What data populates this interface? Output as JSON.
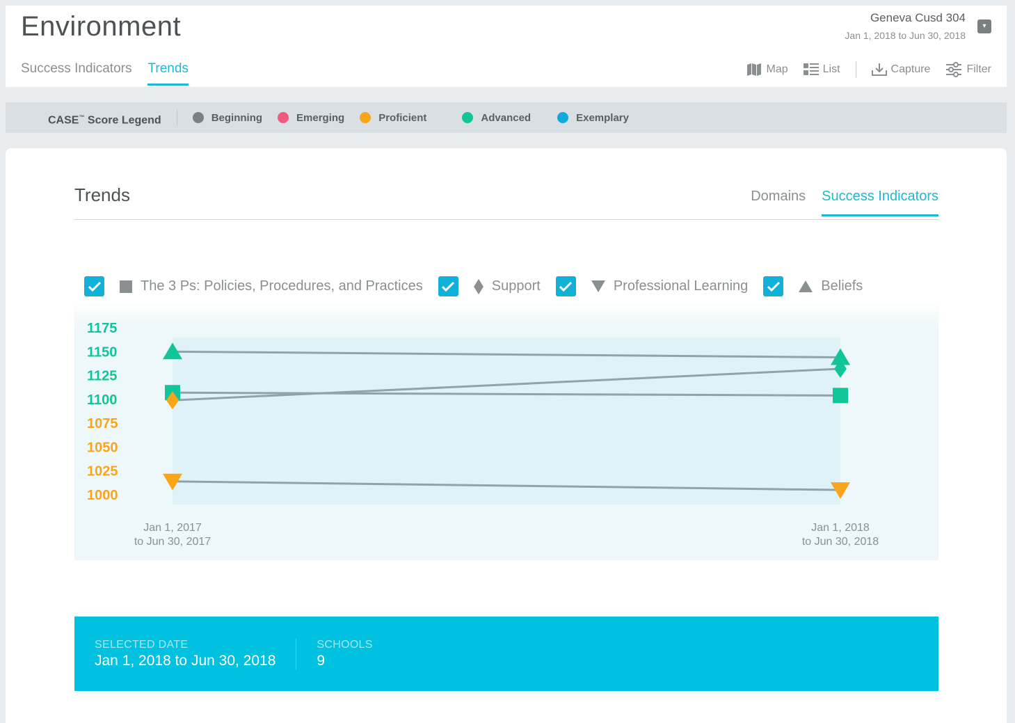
{
  "header": {
    "title": "Environment",
    "tabs": [
      {
        "label": "Success Indicators",
        "active": false
      },
      {
        "label": "Trends",
        "active": true
      }
    ],
    "district": {
      "name": "Geneva Cusd 304",
      "range": "Jan 1, 2018 to Jun 30, 2018"
    },
    "toolbar": {
      "map": "Map",
      "list": "List",
      "capture": "Capture",
      "filter": "Filter"
    }
  },
  "legend": {
    "title": "CASE",
    "title_mark": "™",
    "title_suffix": " Score Legend",
    "items": [
      {
        "label": "Beginning",
        "color": "#7b8083"
      },
      {
        "label": "Emerging",
        "color": "#ef5b7c"
      },
      {
        "label": "Proficient",
        "color": "#f9a51a"
      },
      {
        "label": "Advanced",
        "color": "#11c598"
      },
      {
        "label": "Exemplary",
        "color": "#12a9e0"
      }
    ]
  },
  "card": {
    "title": "Trends",
    "tabs": [
      {
        "label": "Domains",
        "active": false
      },
      {
        "label": "Success Indicators",
        "active": true
      }
    ]
  },
  "series_toggles": [
    {
      "label": "The 3 Ps: Policies, Procedures, and Practices",
      "icon": "square-icon",
      "checked": true
    },
    {
      "label": "Support",
      "icon": "diamond-icon",
      "checked": true
    },
    {
      "label": "Professional Learning",
      "icon": "triangle-down-icon",
      "checked": true
    },
    {
      "label": "Beliefs",
      "icon": "triangle-up-icon",
      "checked": true
    }
  ],
  "chart_data": {
    "type": "line",
    "x": [
      "Jan 1, 2017 to Jun 30, 2017",
      "Jan 1, 2018 to Jun 30, 2018"
    ],
    "x_tick_lines": [
      [
        "Jan 1, 2017",
        "to Jun 30, 2017"
      ],
      [
        "Jan 1, 2018",
        "to Jun 30, 2018"
      ]
    ],
    "y_ticks": [
      1175,
      1150,
      1125,
      1100,
      1075,
      1050,
      1025,
      1000
    ],
    "ylim": [
      1000,
      1175
    ],
    "series": [
      {
        "name": "The 3 Ps: Policies, Procedures, and Practices",
        "marker": "square",
        "values": [
          1107,
          1104
        ]
      },
      {
        "name": "Support",
        "marker": "diamond",
        "values": [
          1099,
          1132
        ]
      },
      {
        "name": "Professional Learning",
        "marker": "triangle-down",
        "values": [
          1014,
          1005
        ]
      },
      {
        "name": "Beliefs",
        "marker": "triangle-up",
        "values": [
          1150,
          1144
        ]
      }
    ],
    "band_colors": {
      "advanced": "#11c598",
      "proficient": "#f9a51a"
    },
    "line_color": "#8fa4a8"
  },
  "summary": {
    "selected_date_label": "SELECTED DATE",
    "selected_date_value": "Jan 1, 2018 to Jun 30, 2018",
    "schools_label": "SCHOOLS",
    "schools_value": "9"
  }
}
